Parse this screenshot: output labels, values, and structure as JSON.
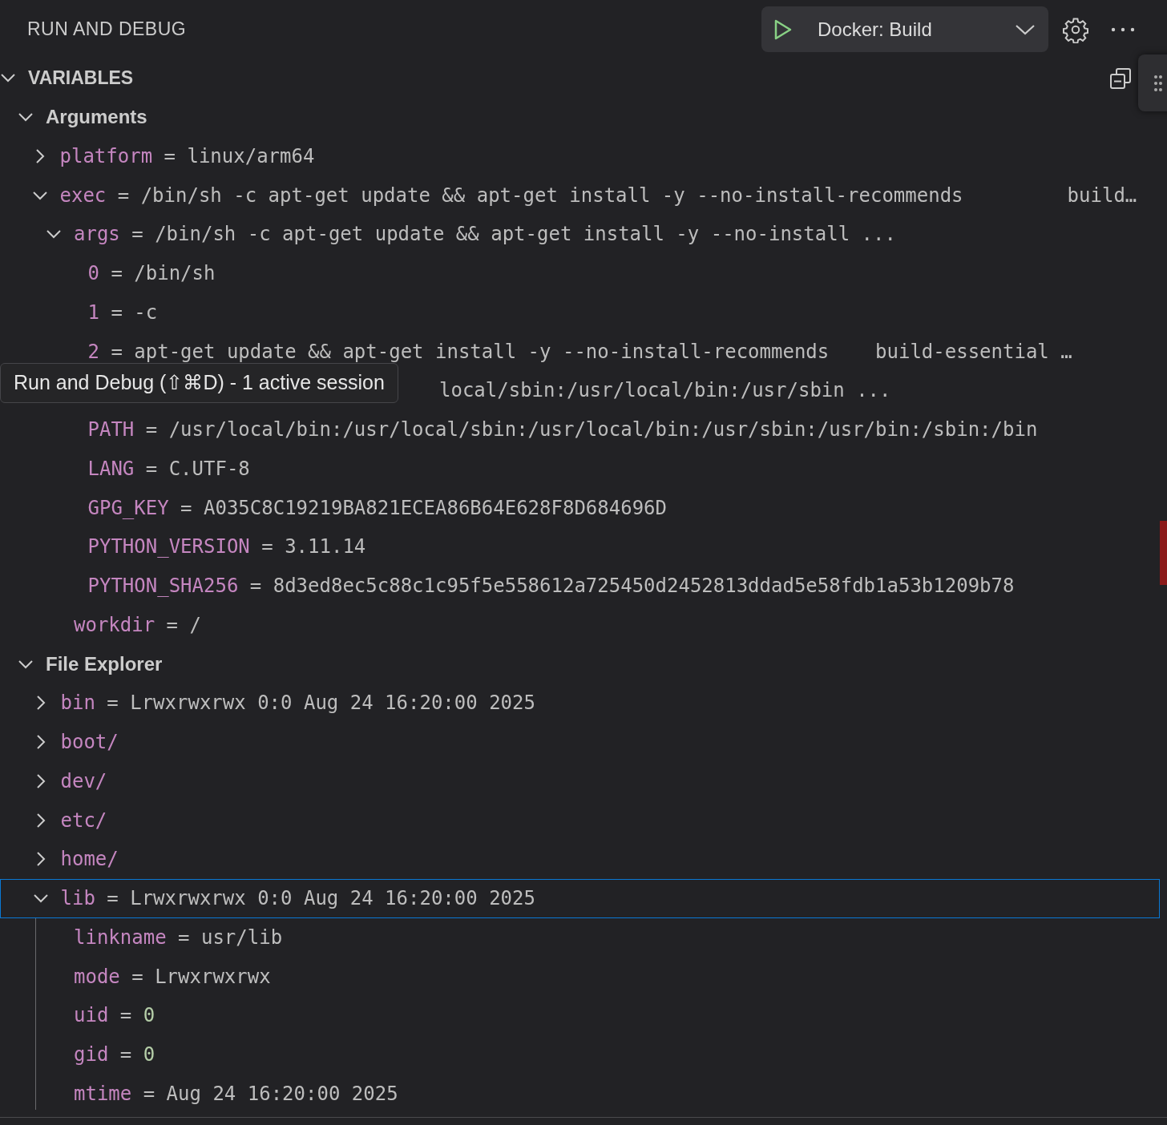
{
  "header": {
    "title": "RUN AND DEBUG",
    "config": "Docker: Build"
  },
  "section": {
    "title": "VARIABLES",
    "expanded": true
  },
  "scopes": [
    {
      "name": "Arguments",
      "expanded": true,
      "children": [
        {
          "name": "platform",
          "sep": "=",
          "value": "linux/arm64",
          "expanded": false
        },
        {
          "name": "exec",
          "sep": "=",
          "value": "/bin/sh -c apt-get update && apt-get install -y --no-install-recommends         build…",
          "expanded": true,
          "children": [
            {
              "kind": "text",
              "name": "args",
              "sep": "=",
              "value": "/bin/sh -c apt-get update && apt-get install -y --no-install ...",
              "expanded": true,
              "children": [
                {
                  "name": "0",
                  "sep": "=",
                  "value": "/bin/sh"
                },
                {
                  "name": "1",
                  "sep": "=",
                  "value": "-c"
                },
                {
                  "name": "2",
                  "sep": "=",
                  "value": "apt-get update && apt-get install -y --no-install-recommends    build-essential …"
                }
              ]
            },
            {
              "kind": "partial",
              "value": "local/sbin:/usr/local/bin:/usr/sbin ...",
              "children": [
                {
                  "name": "PATH",
                  "sep": "=",
                  "value": "/usr/local/bin:/usr/local/sbin:/usr/local/bin:/usr/sbin:/usr/bin:/sbin:/bin"
                },
                {
                  "name": "LANG",
                  "sep": "=",
                  "value": "C.UTF-8"
                },
                {
                  "name": "GPG_KEY",
                  "sep": "=",
                  "value": "A035C8C19219BA821ECEA86B64E628F8D684696D"
                },
                {
                  "name": "PYTHON_VERSION",
                  "sep": "=",
                  "value": "3.11.14"
                },
                {
                  "name": "PYTHON_SHA256",
                  "sep": "=",
                  "value": "8d3ed8ec5c88c1c95f5e558612a725450d2452813ddad5e58fdb1a53b1209b78"
                }
              ]
            },
            {
              "kind": "text",
              "name": "workdir",
              "sep": "=",
              "value": "/"
            }
          ]
        }
      ]
    },
    {
      "name": "File Explorer",
      "expanded": true,
      "children": [
        {
          "name": "bin",
          "sep": "=",
          "value": "Lrwxrwxrwx 0:0 Aug 24 16:20:00 2025",
          "expanded": false,
          "selected": false
        },
        {
          "name": "boot/",
          "expanded": false,
          "selected": false
        },
        {
          "name": "dev/",
          "expanded": false,
          "selected": false
        },
        {
          "name": "etc/",
          "expanded": false,
          "selected": false
        },
        {
          "name": "home/",
          "expanded": false,
          "selected": false
        },
        {
          "name": "lib",
          "sep": "=",
          "value": "Lrwxrwxrwx 0:0 Aug 24 16:20:00 2025",
          "expanded": true,
          "selected": true,
          "children": [
            {
              "kind": "text",
              "name": "linkname",
              "sep": "=",
              "value": "usr/lib"
            },
            {
              "kind": "text",
              "name": "mode",
              "sep": "=",
              "value": "Lrwxrwxrwx"
            },
            {
              "kind": "number",
              "name": "uid",
              "sep": "=",
              "value": "0"
            },
            {
              "kind": "number",
              "name": "gid",
              "sep": "=",
              "value": "0"
            },
            {
              "kind": "text",
              "name": "mtime",
              "sep": "=",
              "value": "Aug 24 16:20:00 2025"
            }
          ]
        }
      ]
    }
  ],
  "tooltip": "Run and Debug (⇧⌘D) - 1 active session"
}
